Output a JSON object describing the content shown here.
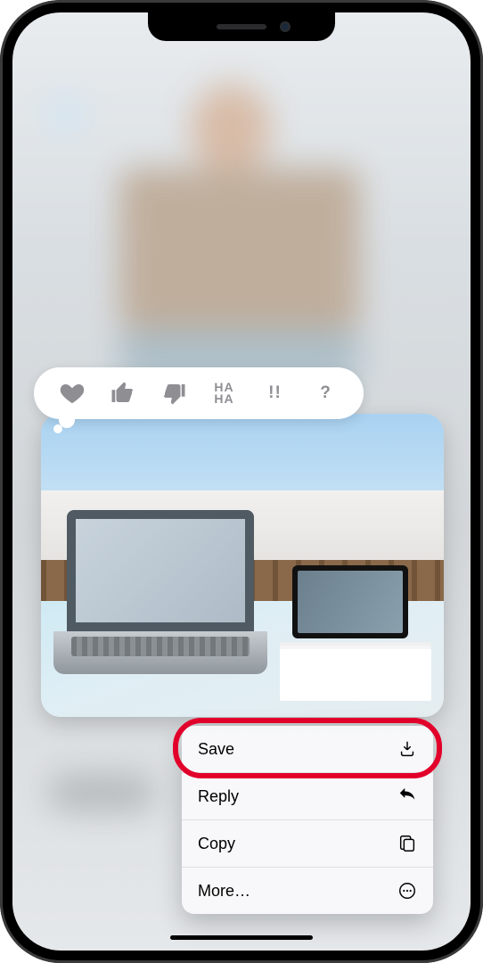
{
  "tapback": {
    "heart": "heart-icon",
    "thumbsUp": "thumbs-up-icon",
    "thumbsDown": "thumbs-down-icon",
    "hahaTop": "HA",
    "hahaBottom": "HA",
    "emphasis": "!!",
    "question": "?"
  },
  "menu": {
    "save": "Save",
    "reply": "Reply",
    "copy": "Copy",
    "more": "More…"
  },
  "annotation": {
    "highlight_target": "save"
  }
}
